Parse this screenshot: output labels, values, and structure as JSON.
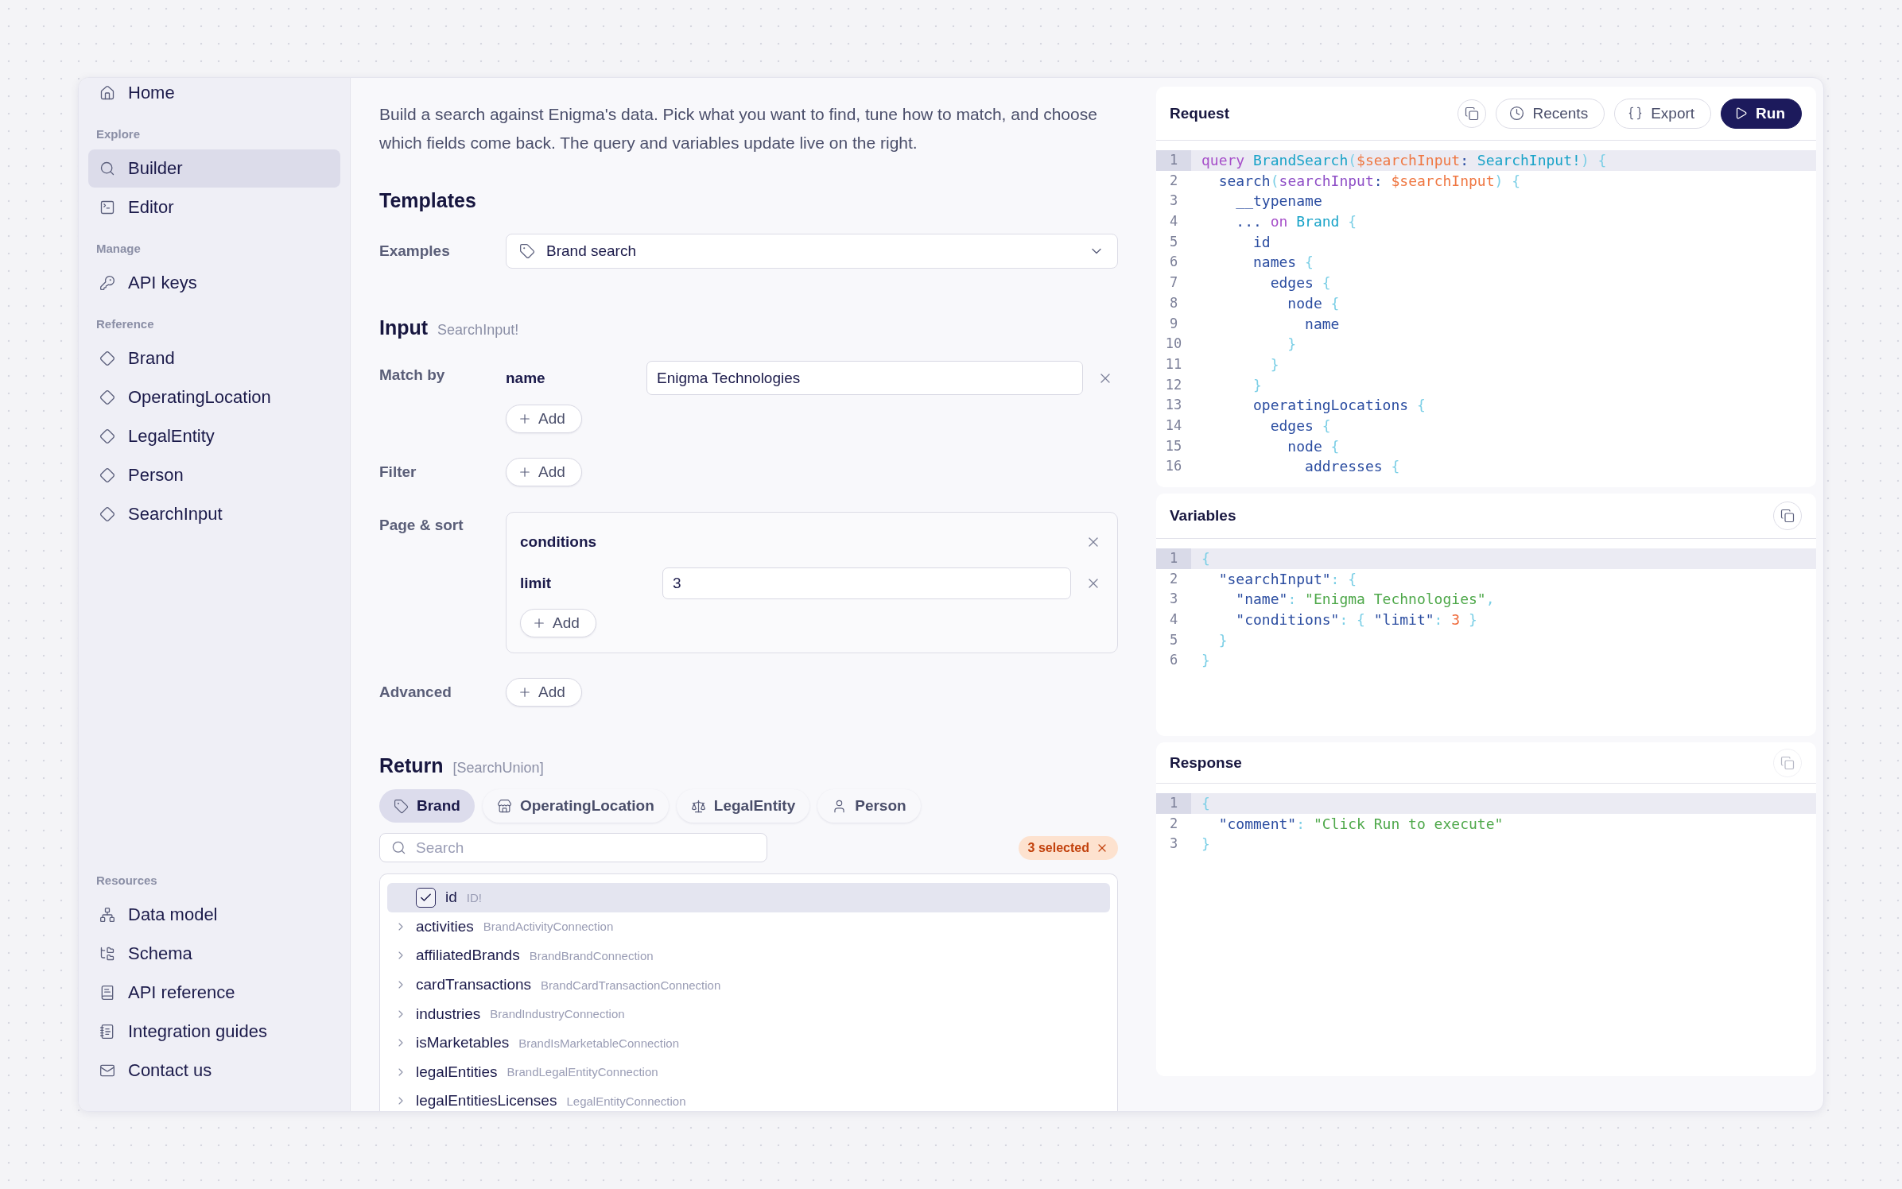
{
  "sidebar": {
    "sections": [
      {
        "items": [
          {
            "label": "Home",
            "selected": false
          }
        ]
      },
      {
        "heading": "Explore",
        "items": [
          {
            "label": "Builder",
            "selected": true
          },
          {
            "label": "Editor",
            "selected": false
          }
        ]
      },
      {
        "heading": "Manage",
        "items": [
          {
            "label": "API keys",
            "selected": false
          }
        ]
      },
      {
        "heading": "Reference",
        "items": [
          {
            "label": "Brand",
            "selected": false
          },
          {
            "label": "OperatingLocation",
            "selected": false
          },
          {
            "label": "LegalEntity",
            "selected": false
          },
          {
            "label": "Person",
            "selected": false
          },
          {
            "label": "SearchInput",
            "selected": false
          }
        ]
      }
    ],
    "footer": {
      "heading": "Resources",
      "items": [
        {
          "label": "Data model",
          "selected": false
        },
        {
          "label": "Schema",
          "selected": false
        },
        {
          "label": "API reference",
          "selected": false
        },
        {
          "label": "Integration guides",
          "selected": false
        },
        {
          "label": "Contact us",
          "selected": false
        }
      ]
    }
  },
  "builder": {
    "intro": "Build a search against Enigma's data. Pick what you want to find, tune how to match, and choose which fields come back. The query and variables update live on the right.",
    "templates": {
      "heading": "Templates",
      "label": "Examples",
      "value": "Brand search"
    },
    "input": {
      "heading": "Input",
      "type": "SearchInput!",
      "match_by": {
        "label": "Match by",
        "field_name": "name",
        "value": "Enigma Technologies",
        "add": "Add"
      },
      "filter": {
        "label": "Filter",
        "add": "Add"
      },
      "page_sort": {
        "label": "Page & sort",
        "group": "conditions",
        "field_name": "limit",
        "value": "3",
        "add": "Add"
      },
      "advanced": {
        "label": "Advanced",
        "add": "Add"
      }
    },
    "return": {
      "heading": "Return",
      "type": "[SearchUnion]",
      "tabs": [
        {
          "label": "Brand",
          "selected": true
        },
        {
          "label": "OperatingLocation",
          "selected": false
        },
        {
          "label": "LegalEntity",
          "selected": false
        },
        {
          "label": "Person",
          "selected": false
        }
      ],
      "search": {
        "placeholder": "Search"
      },
      "badge": "3 selected",
      "fields": [
        {
          "name": "id",
          "type": "ID!",
          "kind": "scalar",
          "checked": true
        },
        {
          "name": "activities",
          "type": "BrandActivityConnection",
          "kind": "connection",
          "expanded": false
        },
        {
          "name": "affiliatedBrands",
          "type": "BrandBrandConnection",
          "kind": "connection",
          "expanded": false
        },
        {
          "name": "cardTransactions",
          "type": "BrandCardTransactionConnection",
          "kind": "connection",
          "expanded": false
        },
        {
          "name": "industries",
          "type": "BrandIndustryConnection",
          "kind": "connection",
          "expanded": false
        },
        {
          "name": "isMarketables",
          "type": "BrandIsMarketableConnection",
          "kind": "connection",
          "expanded": false
        },
        {
          "name": "legalEntities",
          "type": "BrandLegalEntityConnection",
          "kind": "connection",
          "expanded": false
        },
        {
          "name": "legalEntitiesLicenses",
          "type": "LegalEntityConnection",
          "kind": "connection",
          "expanded": false
        }
      ]
    }
  },
  "request": {
    "title": "Request",
    "copy_disabled": false,
    "recents": "Recents",
    "export": "Export",
    "run": "Run",
    "lines": [
      {
        "n": "1",
        "selected": true,
        "tokens": [
          {
            "kind": "keyword",
            "text": "query "
          },
          {
            "kind": "type",
            "text": "BrandSearch"
          },
          {
            "kind": "punct",
            "text": "("
          },
          {
            "kind": "var",
            "text": "$searchInput"
          },
          {
            "kind": "field",
            "text": ": "
          },
          {
            "kind": "type",
            "text": "SearchInput!"
          },
          {
            "kind": "punct",
            "text": ") {"
          }
        ]
      },
      {
        "n": "2",
        "selected": false,
        "tokens": [
          {
            "kind": "field",
            "text": "  search"
          },
          {
            "kind": "punct",
            "text": "("
          },
          {
            "kind": "arg",
            "text": "searchInput"
          },
          {
            "kind": "field",
            "text": ": "
          },
          {
            "kind": "var",
            "text": "$searchInput"
          },
          {
            "kind": "punct",
            "text": ") {"
          }
        ]
      },
      {
        "n": "3",
        "selected": false,
        "tokens": [
          {
            "kind": "field",
            "text": "    __typename"
          }
        ]
      },
      {
        "n": "4",
        "selected": false,
        "tokens": [
          {
            "kind": "field",
            "text": "    ... "
          },
          {
            "kind": "keyword",
            "text": "on "
          },
          {
            "kind": "type",
            "text": "Brand "
          },
          {
            "kind": "punct",
            "text": "{"
          }
        ]
      },
      {
        "n": "5",
        "selected": false,
        "tokens": [
          {
            "kind": "field",
            "text": "      id"
          }
        ]
      },
      {
        "n": "6",
        "selected": false,
        "tokens": [
          {
            "kind": "field",
            "text": "      names "
          },
          {
            "kind": "punct",
            "text": "{"
          }
        ]
      },
      {
        "n": "7",
        "selected": false,
        "tokens": [
          {
            "kind": "field",
            "text": "        edges "
          },
          {
            "kind": "punct",
            "text": "{"
          }
        ]
      },
      {
        "n": "8",
        "selected": false,
        "tokens": [
          {
            "kind": "field",
            "text": "          node "
          },
          {
            "kind": "punct",
            "text": "{"
          }
        ]
      },
      {
        "n": "9",
        "selected": false,
        "tokens": [
          {
            "kind": "field",
            "text": "            name"
          }
        ]
      },
      {
        "n": "10",
        "selected": false,
        "tokens": [
          {
            "kind": "punct",
            "text": "          }"
          }
        ]
      },
      {
        "n": "11",
        "selected": false,
        "tokens": [
          {
            "kind": "punct",
            "text": "        }"
          }
        ]
      },
      {
        "n": "12",
        "selected": false,
        "tokens": [
          {
            "kind": "punct",
            "text": "      }"
          }
        ]
      },
      {
        "n": "13",
        "selected": false,
        "tokens": [
          {
            "kind": "field",
            "text": "      operatingLocations "
          },
          {
            "kind": "punct",
            "text": "{"
          }
        ]
      },
      {
        "n": "14",
        "selected": false,
        "tokens": [
          {
            "kind": "field",
            "text": "        edges "
          },
          {
            "kind": "punct",
            "text": "{"
          }
        ]
      },
      {
        "n": "15",
        "selected": false,
        "tokens": [
          {
            "kind": "field",
            "text": "          node "
          },
          {
            "kind": "punct",
            "text": "{"
          }
        ]
      },
      {
        "n": "16",
        "selected": false,
        "tokens": [
          {
            "kind": "field",
            "text": "            addresses "
          },
          {
            "kind": "punct",
            "text": "{"
          }
        ]
      }
    ]
  },
  "variables": {
    "title": "Variables",
    "copy_disabled": false,
    "lines": [
      {
        "n": "1",
        "selected": true,
        "tokens": [
          {
            "kind": "punct",
            "text": "{"
          }
        ]
      },
      {
        "n": "2",
        "selected": false,
        "tokens": [
          {
            "kind": "key",
            "text": "  \"searchInput\""
          },
          {
            "kind": "punct",
            "text": ": {"
          }
        ]
      },
      {
        "n": "3",
        "selected": false,
        "tokens": [
          {
            "kind": "key",
            "text": "    \"name\""
          },
          {
            "kind": "punct",
            "text": ": "
          },
          {
            "kind": "string",
            "text": "\"Enigma Technologies\""
          },
          {
            "kind": "punct",
            "text": ","
          }
        ]
      },
      {
        "n": "4",
        "selected": false,
        "tokens": [
          {
            "kind": "key",
            "text": "    \"conditions\""
          },
          {
            "kind": "punct",
            "text": ": { "
          },
          {
            "kind": "key",
            "text": "\"limit\""
          },
          {
            "kind": "punct",
            "text": ": "
          },
          {
            "kind": "number",
            "text": "3"
          },
          {
            "kind": "punct",
            "text": " }"
          }
        ]
      },
      {
        "n": "5",
        "selected": false,
        "tokens": [
          {
            "kind": "punct",
            "text": "  }"
          }
        ]
      },
      {
        "n": "6",
        "selected": false,
        "tokens": [
          {
            "kind": "punct",
            "text": "}"
          }
        ]
      }
    ]
  },
  "response": {
    "title": "Response",
    "copy_disabled": true,
    "lines": [
      {
        "n": "1",
        "selected": true,
        "tokens": [
          {
            "kind": "punct",
            "text": "{"
          }
        ]
      },
      {
        "n": "2",
        "selected": false,
        "tokens": [
          {
            "kind": "key",
            "text": "  \"comment\""
          },
          {
            "kind": "punct",
            "text": ": "
          },
          {
            "kind": "string",
            "text": "\"Click Run to execute\""
          }
        ]
      },
      {
        "n": "3",
        "selected": false,
        "tokens": [
          {
            "kind": "punct",
            "text": "}"
          }
        ]
      }
    ]
  }
}
